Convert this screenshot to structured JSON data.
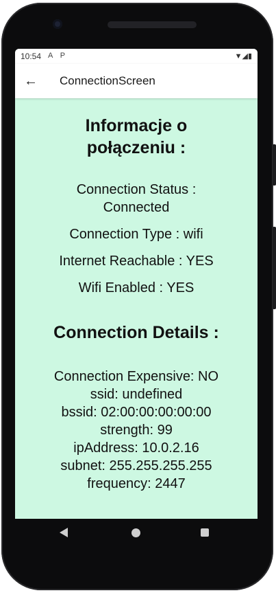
{
  "status_bar": {
    "time": "10:54",
    "icons": "A P",
    "right": "▼◢▮"
  },
  "app_bar": {
    "title": "ConnectionScreen"
  },
  "section1": {
    "heading_line1": "Informacje o",
    "heading_line2": "połączeniu :",
    "status_line1": "Connection Status :",
    "status_line2": "Connected",
    "type": "Connection Type : wifi",
    "reachable": "Internet Reachable : YES",
    "wifi_enabled": "Wifi Enabled : YES"
  },
  "section2": {
    "heading": "Connection Details :",
    "details": [
      "Connection Expensive: NO",
      "ssid: undefined",
      "bssid: 02:00:00:00:00:00",
      "strength: 99",
      "ipAddress: 10.0.2.16",
      "subnet: 255.255.255.255",
      "frequency: 2447"
    ]
  }
}
